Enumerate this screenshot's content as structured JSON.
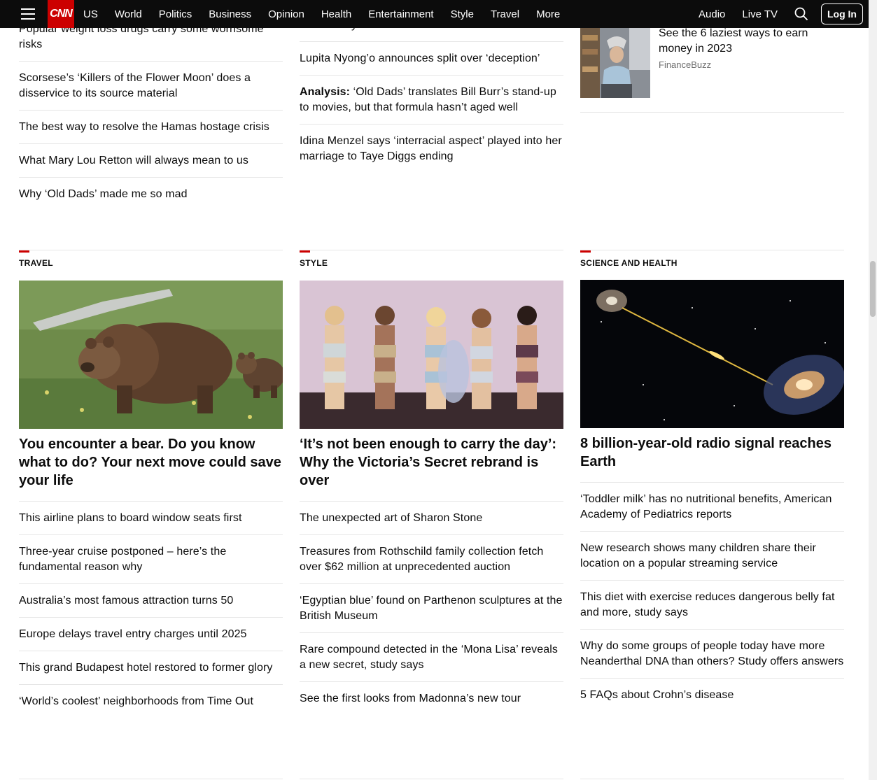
{
  "nav": {
    "logo": "CNN",
    "links": [
      "US",
      "World",
      "Politics",
      "Business",
      "Opinion",
      "Health",
      "Entertainment",
      "Style",
      "Travel",
      "More"
    ],
    "right_links": [
      "Audio",
      "Live TV"
    ],
    "login": "Log In"
  },
  "top": {
    "col1": [
      "Popular weight loss drugs carry some worrisome risks",
      "Scorsese’s ‘Killers of the Flower Moon’ does a disservice to its source material",
      "The best way to resolve the Hamas hostage crisis",
      "What Mary Lou Retton will always mean to us",
      "Why ‘Old Dads’ made me so mad"
    ],
    "col2_first": "authenticity to the film",
    "col2": [
      "Lupita Nyong’o announces split over ‘deception’",
      "Idina Menzel says ‘interracial aspect’ played into her marriage to Taye Diggs ending"
    ],
    "col2_analysis_label": "Analysis:",
    "col2_analysis_text": " ‘Old Dads’ translates Bill Burr’s stand-up to movies, but that formula hasn’t aged well",
    "ad": {
      "title": "See the 6 laziest ways to earn money in 2023",
      "source": "FinanceBuzz"
    }
  },
  "travel": {
    "section": "TRAVEL",
    "headline": "You encounter a bear. Do you know what to do? Your next move could save your life",
    "items": [
      "This airline plans to board window seats first",
      "Three-year cruise postponed – here’s the fundamental reason why",
      "Australia’s most famous attraction turns 50",
      "Europe delays travel entry charges until 2025",
      "This grand Budapest hotel restored to former glory",
      "‘World’s coolest’ neighborhoods from Time Out"
    ]
  },
  "style": {
    "section": "STYLE",
    "headline": "‘It’s not been enough to carry the day’: Why the Victoria’s Secret rebrand is over",
    "items": [
      "The unexpected art of Sharon Stone",
      "Treasures from Rothschild family collection fetch over $62 million at unprecedented auction",
      "‘Egyptian blue’ found on Parthenon sculptures at the British Museum",
      "Rare compound detected in the ‘Mona Lisa’ reveals a new secret, study says",
      "See the first looks from Madonna’s new tour"
    ]
  },
  "science": {
    "section": "SCIENCE AND HEALTH",
    "headline": "8 billion-year-old radio signal reaches Earth",
    "items": [
      "‘Toddler milk’ has no nutritional benefits, American Academy of Pediatrics reports",
      "New research shows many children share their location on a popular streaming service",
      "This diet with exercise reduces dangerous belly fat and more, study says",
      "Why do some groups of people today have more Neanderthal DNA than others? Study offers answers",
      "5 FAQs about Crohn’s disease"
    ]
  },
  "colors": {
    "brand": "#cc0000",
    "nav_bg": "#0c0c0c",
    "rule": "#e6e6e6"
  }
}
